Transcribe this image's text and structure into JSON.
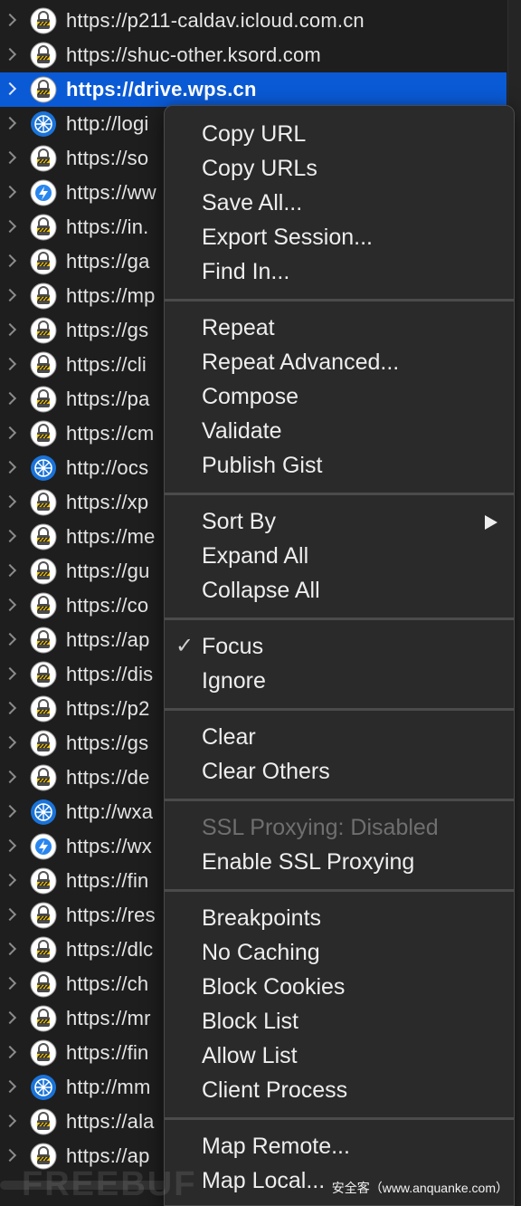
{
  "host_list": [
    {
      "url": "https://p211-caldav.icloud.com.cn",
      "icon": "lock-icon",
      "selected": false
    },
    {
      "url": "https://shuc-other.ksord.com",
      "icon": "lock-icon",
      "selected": false
    },
    {
      "url": "https://drive.wps.cn",
      "icon": "lock-icon",
      "selected": true
    },
    {
      "url": "http://logi",
      "icon": "globe-icon",
      "selected": false
    },
    {
      "url": "https://so",
      "icon": "lock-icon",
      "selected": false
    },
    {
      "url": "https://ww",
      "icon": "lightning-icon",
      "selected": false
    },
    {
      "url": "https://in.",
      "icon": "lock-icon",
      "selected": false
    },
    {
      "url": "https://ga",
      "icon": "lock-icon",
      "selected": false
    },
    {
      "url": "https://mp",
      "icon": "lock-icon",
      "selected": false
    },
    {
      "url": "https://gs",
      "icon": "lock-icon",
      "selected": false
    },
    {
      "url": "https://cli",
      "icon": "lock-icon",
      "selected": false
    },
    {
      "url": "https://pa",
      "icon": "lock-icon",
      "selected": false
    },
    {
      "url": "https://cm",
      "icon": "lock-icon",
      "selected": false
    },
    {
      "url": "http://ocs",
      "icon": "globe-icon",
      "selected": false
    },
    {
      "url": "https://xp",
      "icon": "lock-icon",
      "selected": false
    },
    {
      "url": "https://me",
      "icon": "lock-icon",
      "selected": false
    },
    {
      "url": "https://gu",
      "icon": "lock-icon",
      "selected": false
    },
    {
      "url": "https://co",
      "icon": "lock-icon",
      "selected": false
    },
    {
      "url": "https://ap",
      "icon": "lock-icon",
      "selected": false
    },
    {
      "url": "https://dis",
      "icon": "lock-icon",
      "selected": false
    },
    {
      "url": "https://p2",
      "icon": "lock-icon",
      "selected": false
    },
    {
      "url": "https://gs",
      "icon": "lock-icon",
      "selected": false
    },
    {
      "url": "https://de",
      "icon": "lock-icon",
      "selected": false
    },
    {
      "url": "http://wxa",
      "icon": "globe-icon",
      "selected": false
    },
    {
      "url": "https://wx",
      "icon": "lightning-icon",
      "selected": false
    },
    {
      "url": "https://fin",
      "icon": "lock-icon",
      "selected": false
    },
    {
      "url": "https://res",
      "icon": "lock-icon",
      "selected": false
    },
    {
      "url": "https://dlc",
      "icon": "lock-icon",
      "selected": false
    },
    {
      "url": "https://ch",
      "icon": "lock-icon",
      "selected": false
    },
    {
      "url": "https://mr",
      "icon": "lock-icon",
      "selected": false
    },
    {
      "url": "https://fin",
      "icon": "lock-icon",
      "selected": false
    },
    {
      "url": "http://mm",
      "icon": "globe-icon",
      "selected": false
    },
    {
      "url": "https://ala",
      "icon": "lock-icon",
      "selected": false
    },
    {
      "url": "https://ap",
      "icon": "lock-icon",
      "selected": false
    }
  ],
  "context_menu": {
    "groups": [
      {
        "items": [
          {
            "label": "Copy URL"
          },
          {
            "label": "Copy URLs"
          },
          {
            "label": "Save All..."
          },
          {
            "label": "Export Session..."
          },
          {
            "label": "Find In..."
          }
        ]
      },
      {
        "items": [
          {
            "label": "Repeat"
          },
          {
            "label": "Repeat Advanced..."
          },
          {
            "label": "Compose"
          },
          {
            "label": "Validate"
          },
          {
            "label": "Publish Gist"
          }
        ]
      },
      {
        "items": [
          {
            "label": "Sort By",
            "submenu": true
          },
          {
            "label": "Expand All"
          },
          {
            "label": "Collapse All"
          }
        ]
      },
      {
        "items": [
          {
            "label": "Focus",
            "checked": true
          },
          {
            "label": "Ignore"
          }
        ]
      },
      {
        "items": [
          {
            "label": "Clear"
          },
          {
            "label": "Clear Others"
          }
        ]
      },
      {
        "items": [
          {
            "label": "SSL Proxying: Disabled",
            "disabled": true
          },
          {
            "label": "Enable SSL Proxying"
          }
        ]
      },
      {
        "items": [
          {
            "label": "Breakpoints"
          },
          {
            "label": "No Caching"
          },
          {
            "label": "Block Cookies"
          },
          {
            "label": "Block List"
          },
          {
            "label": "Allow List"
          },
          {
            "label": "Client Process"
          }
        ]
      },
      {
        "items": [
          {
            "label": "Map Remote..."
          },
          {
            "label": "Map Local..."
          }
        ]
      }
    ],
    "check_glyph": "✓"
  },
  "watermark": {
    "text": "安全客（www.anquanke.com）",
    "logo": "FREEBUF"
  },
  "colors": {
    "selection": "#0a5ad6",
    "background": "#1e1e1e",
    "menu_background": "#2a2a2a",
    "lock_icon_bg": "#ffffff",
    "globe_icon_bg": "#1a73d9"
  }
}
